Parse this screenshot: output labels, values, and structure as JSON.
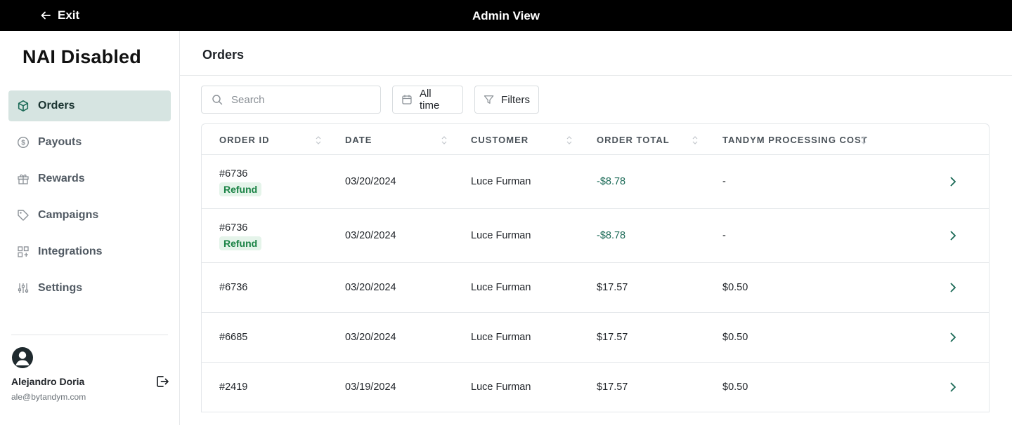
{
  "topbar": {
    "exit_label": "Exit",
    "title": "Admin View"
  },
  "brand": "NAI Disabled",
  "sidebar": {
    "items": [
      {
        "label": "Orders",
        "icon": "box-icon",
        "active": true
      },
      {
        "label": "Payouts",
        "icon": "dollar-circle-icon",
        "active": false
      },
      {
        "label": "Rewards",
        "icon": "gift-icon",
        "active": false
      },
      {
        "label": "Campaigns",
        "icon": "tag-icon",
        "active": false
      },
      {
        "label": "Integrations",
        "icon": "grid-plus-icon",
        "active": false
      },
      {
        "label": "Settings",
        "icon": "sliders-icon",
        "active": false
      }
    ]
  },
  "user": {
    "name": "Alejandro Doria",
    "email": "ale@bytandym.com"
  },
  "page": {
    "title": "Orders"
  },
  "search": {
    "placeholder": "Search",
    "value": ""
  },
  "toolbar": {
    "time_label": "All time",
    "filters_label": "Filters"
  },
  "table": {
    "columns": [
      "ORDER ID",
      "DATE",
      "CUSTOMER",
      "ORDER TOTAL",
      "TANDYM PROCESSING COST"
    ],
    "rows": [
      {
        "id": "#6736",
        "badge": "Refund",
        "date": "03/20/2024",
        "customer": "Luce Furman",
        "total": "-$8.78",
        "cost": "-"
      },
      {
        "id": "#6736",
        "badge": "Refund",
        "date": "03/20/2024",
        "customer": "Luce Furman",
        "total": "-$8.78",
        "cost": "-"
      },
      {
        "id": "#6736",
        "badge": "",
        "date": "03/20/2024",
        "customer": "Luce Furman",
        "total": "$17.57",
        "cost": "$0.50"
      },
      {
        "id": "#6685",
        "badge": "",
        "date": "03/20/2024",
        "customer": "Luce Furman",
        "total": "$17.57",
        "cost": "$0.50"
      },
      {
        "id": "#2419",
        "badge": "",
        "date": "03/19/2024",
        "customer": "Luce Furman",
        "total": "$17.57",
        "cost": "$0.50"
      }
    ]
  },
  "colors": {
    "topbar": "#000000",
    "active_nav_bg": "#d6e4e1",
    "accent": "#1d6b58",
    "refund_badge_bg": "#e5f4ea",
    "refund_badge_text": "#198244"
  }
}
